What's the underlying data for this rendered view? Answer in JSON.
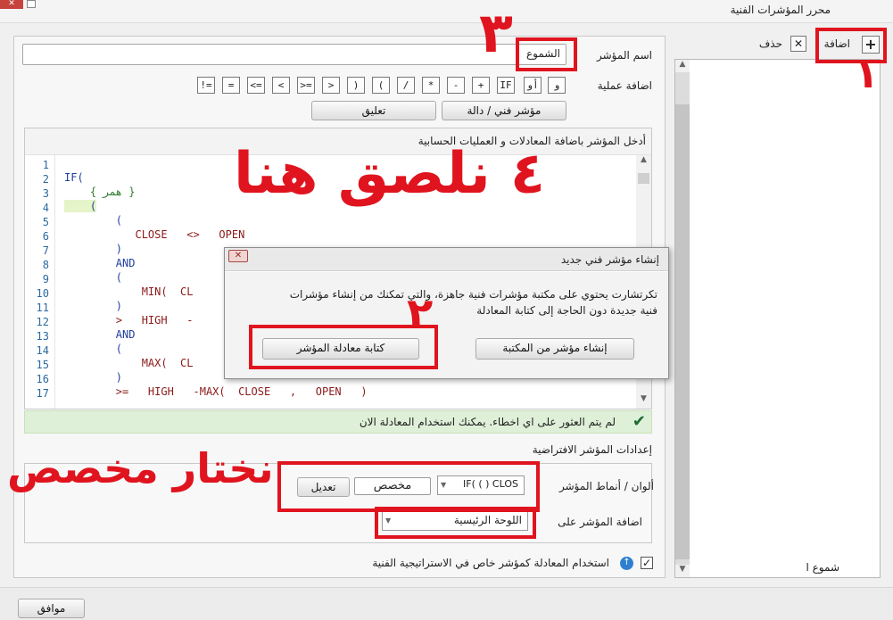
{
  "window": {
    "title": "محرر المؤشرات الفنية"
  },
  "sidebar": {
    "add_label": "اضافة",
    "delete_label": "حذف",
    "items": [
      {
        "label": "شموع ا"
      }
    ]
  },
  "form": {
    "name_label": "اسم المؤشر",
    "name_value": "الشموع",
    "ops_label": "اضافة عملية",
    "operators": [
      "و",
      "أو",
      "IF",
      "+",
      "-",
      "*",
      "/",
      "(",
      ")",
      ">",
      ">=",
      "<",
      "<=",
      "=",
      "!="
    ],
    "indicator_button": "مؤشر فني / دالة",
    "comment_button": "تعليق"
  },
  "editor": {
    "header": "أدخل المؤشر باضافة المعادلات و العمليات الحسابية",
    "line_numbers": [
      "1",
      "2",
      "3",
      "4",
      "5",
      "6",
      "7",
      "8",
      "9",
      "10",
      "11",
      "12",
      "13",
      "14",
      "15",
      "16",
      "17"
    ],
    "lines": [
      "IF(",
      "    { همر }",
      "    (",
      "        (",
      "           CLOSE   <>   OPEN",
      "        )",
      "        AND",
      "        (",
      "            MIN(  CL",
      "        )",
      "        >   HIGH   -",
      "        AND",
      "        (",
      "            MAX(  CL",
      "        )",
      "        >=   HIGH   -MAX(  CLOSE   ,   OPEN   )"
    ]
  },
  "status": {
    "message": "لم يتم العثور على اي اخطاء. يمكنك استخدام المعادلة الان"
  },
  "defaults": {
    "section_label": "إعدادات المؤشر الافتراضية",
    "colors_label": "ألوان / أنماط المؤشر",
    "colors_value": "IF( ( ) CLOS",
    "custom_value": "مخصص",
    "edit_button": "تعديل",
    "add_on_label": "اضافة المؤشر على",
    "add_on_value": "اللوحة الرئيسية"
  },
  "use_custom": {
    "label": "استخدام المعادلة كمؤشر خاص في الاستراتيجية الفنية",
    "checked": true
  },
  "footer": {
    "ok_button": "موافق"
  },
  "dialog": {
    "title": "إنشاء مؤشر فني جديد",
    "text_line1": "تكرتشارت يحتوي على مكتبة مؤشرات فنية جاهزة، والتي تمكنك من إنشاء مؤشرات",
    "text_line2": "فنية جديدة دون الحاجة إلى كتابة المعادلة",
    "library_button": "إنشاء مؤشر من المكتبة",
    "write_button": "كتابة معادلة المؤشر"
  },
  "annotations": {
    "step1": "١",
    "step2": "٢",
    "step3": "٣",
    "step4_text": "٤ نلصق هنا",
    "choose_custom": "نختار مخصص",
    "color": "#e0141e"
  },
  "colors": {
    "status_ok": "#dff0d8",
    "check": "#1e6b34",
    "line_number": "#2b6aa0"
  }
}
